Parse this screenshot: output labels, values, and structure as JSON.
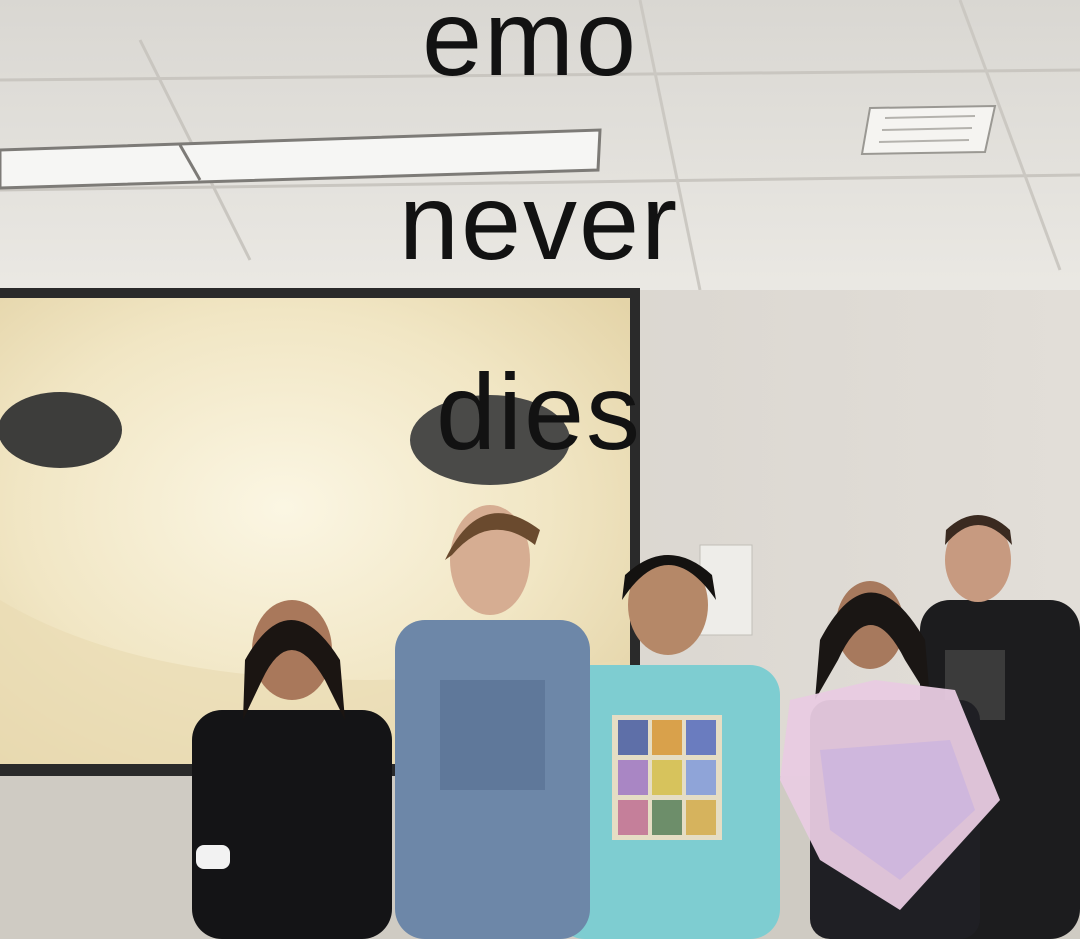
{
  "caption": {
    "line1": "emo",
    "line2": "never",
    "line3": "dies"
  },
  "colors": {
    "ceiling": "#e8e6e1",
    "wall": "#dcd8d1",
    "screen": "#f3ead0",
    "caption_text": "#121212"
  }
}
